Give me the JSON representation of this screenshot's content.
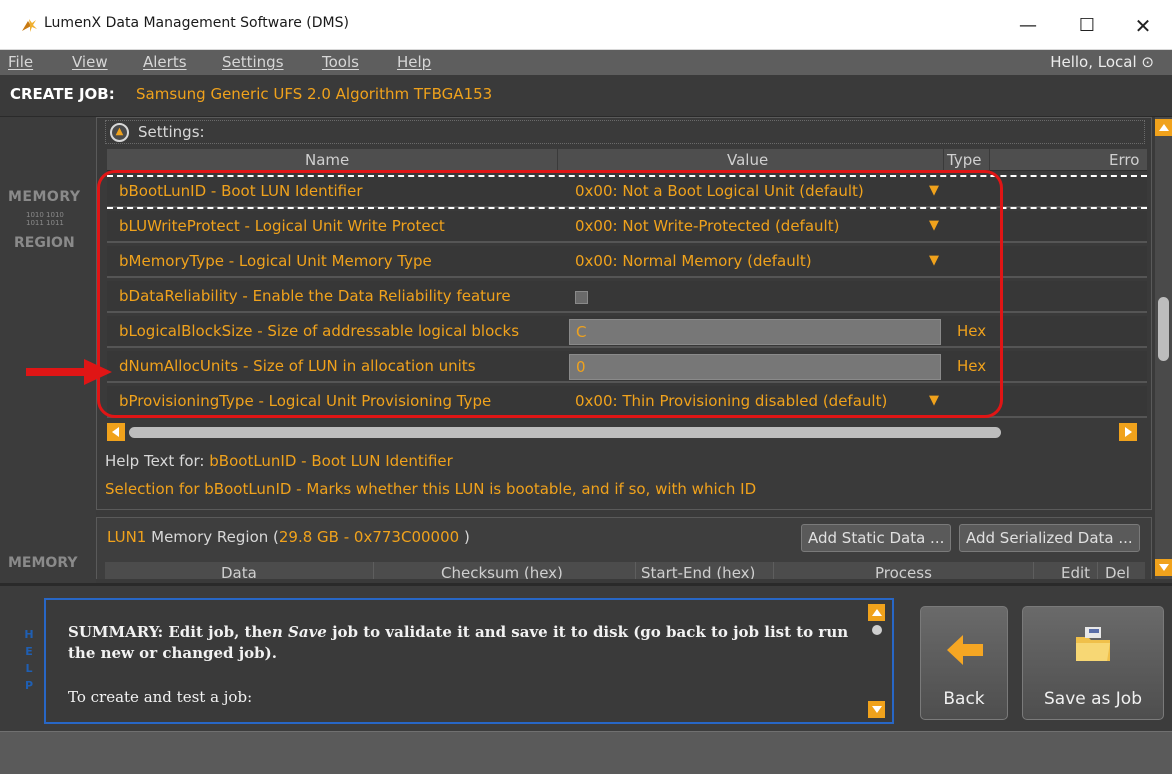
{
  "window": {
    "title": "LumenX Data Management Software (DMS)",
    "min_glyph": "—",
    "max_glyph": "☐",
    "close_glyph": "✕"
  },
  "menu": {
    "items": [
      "File",
      "View",
      "Alerts",
      "Settings",
      "Tools",
      "Help"
    ],
    "greeting": "Hello, Local ⊙"
  },
  "job": {
    "label": "CREATE JOB:",
    "name": "Samsung Generic UFS 2.0 Algorithm TFBGA153"
  },
  "gutter": {
    "memory": "MEMORY",
    "bits_line1": "1010 1010",
    "bits_line2": "1011 1011",
    "region": "REGION",
    "memory2": "MEMORY"
  },
  "settings": {
    "title": "Settings:",
    "headers": {
      "name": "Name",
      "value": "Value",
      "type": "Type",
      "error": "Erro"
    },
    "rows": [
      {
        "name": "bBootLunID - Boot LUN Identifier",
        "value": "0x00: Not a Boot Logical Unit (default)",
        "kind": "dropdown",
        "arrow": "▼"
      },
      {
        "name": "bLUWriteProtect - Logical Unit Write Protect",
        "value": "0x00: Not Write-Protected (default)",
        "kind": "dropdown",
        "arrow": "▼"
      },
      {
        "name": "bMemoryType - Logical Unit Memory Type",
        "value": "0x00: Normal Memory (default)",
        "kind": "dropdown",
        "arrow": "▼"
      },
      {
        "name": "bDataReliability - Enable the Data Reliability feature",
        "value": "",
        "kind": "checkbox",
        "checked": false
      },
      {
        "name": "bLogicalBlockSize - Size of addressable logical blocks",
        "value": "C",
        "kind": "hex",
        "type": "Hex"
      },
      {
        "name": "dNumAllocUnits - Size of LUN in allocation units",
        "value": "0",
        "kind": "hex",
        "type": "Hex"
      },
      {
        "name": "bProvisioningType - Logical Unit Provisioning Type",
        "value": "0x00: Thin Provisioning disabled (default)",
        "kind": "dropdown",
        "arrow": "▼"
      }
    ],
    "help_prefix": "Help Text for:",
    "help_item": "bBootLunID - Boot LUN Identifier",
    "help_desc": "Selection for bBootLunID - Marks whether this LUN is bootable, and if so, with which ID"
  },
  "lun": {
    "id": "LUN1",
    "label": "Memory Region (",
    "size": "29.8 GB - 0x773C00000",
    "close_paren": ")",
    "add_static": "Add Static Data ...",
    "add_serialized": "Add Serialized Data ...",
    "headers": [
      "Data",
      "Checksum (hex)",
      "Start-End (hex)",
      "Process",
      "Edit",
      "Del"
    ]
  },
  "help": {
    "vertical_label": [
      "H",
      "E",
      "L",
      "P"
    ],
    "summary_lead": "SUMMARY: Edit job, the",
    "summary_em": "n Save",
    "summary_rest": " job to validate it and save it to disk (go back to job list to run the new or changed job).",
    "summary_sub": "To create and test a job:"
  },
  "actions": {
    "back": "Back",
    "save": "Save as Job"
  },
  "colors": {
    "accent": "#f0a21c",
    "highlight": "#e01515",
    "help_border": "#2867c6"
  }
}
